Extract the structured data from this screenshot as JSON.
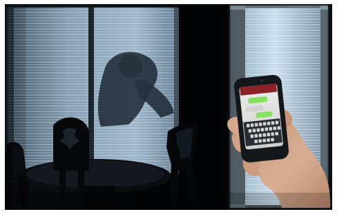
{
  "scene": {
    "colors": {
      "frame": "#ffffff",
      "room_dark": "#050607",
      "blind_light": "#9fb6c8",
      "blind_dark": "#5b6f82",
      "window_glow": "#dff4ff",
      "chair_dark": "#08090b",
      "phone_body": "#17191c",
      "phone_header": "#8a1f25",
      "phone_bubble_green": "#7ed957",
      "phone_bubble_gray": "#d6d6d6",
      "skin": "#d3a588"
    },
    "icons": [
      "window-blinds-icon",
      "smartphone-icon",
      "hand-icon",
      "chair-icon",
      "table-icon"
    ]
  }
}
